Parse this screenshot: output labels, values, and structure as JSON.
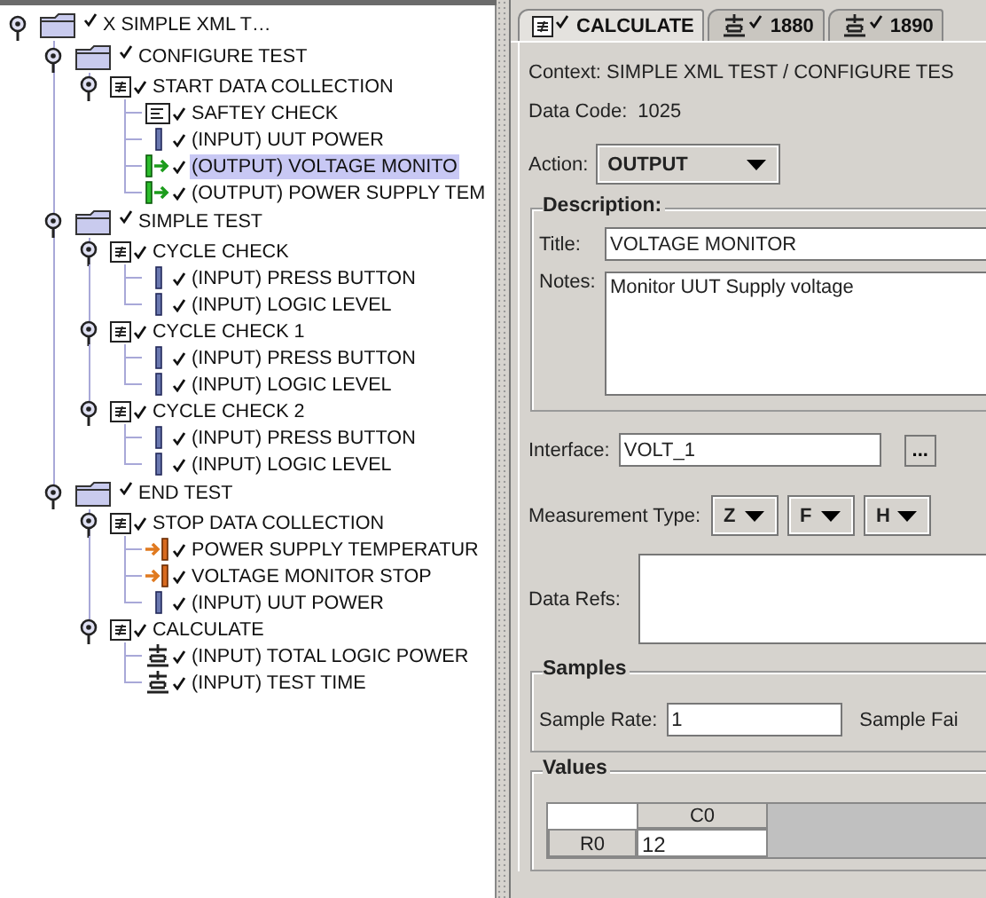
{
  "tree": [
    {
      "label": "X SIMPLE XML T…",
      "kind": "folder",
      "expanded": true,
      "selected": false,
      "children": [
        {
          "label": "CONFIGURE TEST",
          "kind": "folder",
          "expanded": true,
          "selected": false,
          "children": [
            {
              "label": "START DATA COLLECTION",
              "kind": "group",
              "expanded": true,
              "selected": false,
              "children": [
                {
                  "label": "SAFTEY CHECK",
                  "kind": "note",
                  "selected": false
                },
                {
                  "label": "(INPUT) UUT POWER",
                  "kind": "input",
                  "selected": false
                },
                {
                  "label": "(OUTPUT) VOLTAGE MONITO",
                  "kind": "output",
                  "selected": true
                },
                {
                  "label": "(OUTPUT) POWER SUPPLY TEM",
                  "kind": "output",
                  "selected": false
                }
              ]
            }
          ]
        },
        {
          "label": "SIMPLE TEST",
          "kind": "folder",
          "expanded": true,
          "selected": false,
          "children": [
            {
              "label": "CYCLE CHECK",
              "kind": "group",
              "expanded": true,
              "selected": false,
              "children": [
                {
                  "label": "(INPUT) PRESS BUTTON",
                  "kind": "input",
                  "selected": false
                },
                {
                  "label": "(INPUT) LOGIC LEVEL",
                  "kind": "input",
                  "selected": false
                }
              ]
            },
            {
              "label": "CYCLE CHECK 1",
              "kind": "group",
              "expanded": true,
              "selected": false,
              "children": [
                {
                  "label": "(INPUT) PRESS BUTTON",
                  "kind": "input",
                  "selected": false
                },
                {
                  "label": "(INPUT) LOGIC LEVEL",
                  "kind": "input",
                  "selected": false
                }
              ]
            },
            {
              "label": "CYCLE CHECK 2",
              "kind": "group",
              "expanded": true,
              "selected": false,
              "children": [
                {
                  "label": "(INPUT) PRESS BUTTON",
                  "kind": "input",
                  "selected": false
                },
                {
                  "label": "(INPUT) LOGIC LEVEL",
                  "kind": "input",
                  "selected": false
                }
              ]
            }
          ]
        },
        {
          "label": "END TEST",
          "kind": "folder",
          "expanded": true,
          "selected": false,
          "children": [
            {
              "label": "STOP DATA COLLECTION",
              "kind": "group",
              "expanded": true,
              "selected": false,
              "children": [
                {
                  "label": "POWER SUPPLY TEMPERATUR",
                  "kind": "stop",
                  "selected": false
                },
                {
                  "label": "VOLTAGE MONITOR STOP",
                  "kind": "stop",
                  "selected": false
                },
                {
                  "label": "(INPUT) UUT POWER",
                  "kind": "input",
                  "selected": false
                }
              ]
            },
            {
              "label": "CALCULATE",
              "kind": "group",
              "expanded": true,
              "selected": false,
              "children": [
                {
                  "label": "(INPUT) TOTAL LOGIC POWER",
                  "kind": "calc",
                  "selected": false
                },
                {
                  "label": "(INPUT) TEST TIME",
                  "kind": "calc",
                  "selected": false
                }
              ]
            }
          ]
        }
      ]
    }
  ],
  "tabs": [
    {
      "label": "CALCULATE",
      "kind": "group",
      "selected": true
    },
    {
      "label": "1880",
      "kind": "calc",
      "selected": false
    },
    {
      "label": "1890",
      "kind": "calc",
      "selected": false
    }
  ],
  "context": "Context: SIMPLE XML TEST / CONFIGURE TES",
  "data_code": {
    "label": "Data Code:",
    "value": "1025"
  },
  "action": {
    "label": "Action:",
    "value": "OUTPUT"
  },
  "description": {
    "legend": "Description:",
    "title_label": "Title:",
    "title": "VOLTAGE MONITOR",
    "notes_label": "Notes:",
    "notes": "Monitor UUT Supply voltage"
  },
  "interface": {
    "label": "Interface:",
    "value": "VOLT_1",
    "button": "..."
  },
  "measurement_type": {
    "label": "Measurement Type:",
    "options": [
      "Z",
      "F",
      "H"
    ]
  },
  "data_refs": {
    "label": "Data Refs:"
  },
  "samples": {
    "legend": "Samples",
    "rate_label": "Sample Rate:",
    "rate": "1",
    "label_2": "Sample Fai"
  },
  "values": {
    "legend": "Values",
    "columns": [
      "C0"
    ],
    "rows": [
      {
        "header": "R0",
        "cells": [
          "12"
        ]
      }
    ]
  }
}
